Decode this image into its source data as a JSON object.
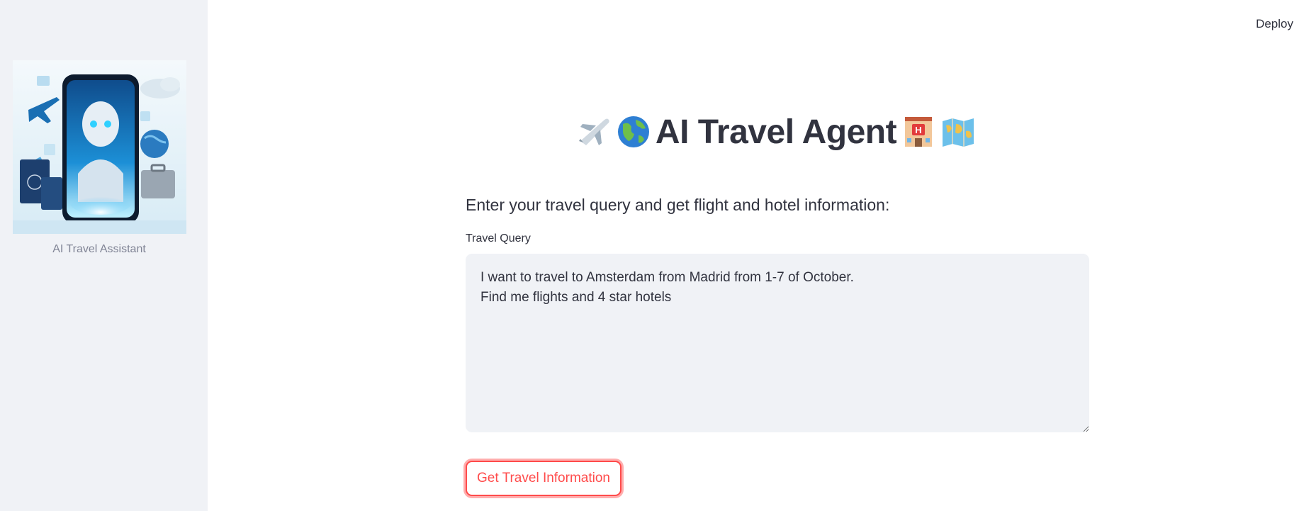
{
  "header": {
    "deploy_label": "Deploy"
  },
  "sidebar": {
    "image_icon": "ai-robot-smartphone-travel-illustration",
    "caption": "AI Travel Assistant"
  },
  "main": {
    "title": {
      "leading_icons": [
        "airplane-icon",
        "globe-icon"
      ],
      "text": "AI Travel Agent",
      "trailing_icons": [
        "hotel-icon",
        "map-icon"
      ]
    },
    "subheader": "Enter your travel query and get flight and hotel information:",
    "query_field": {
      "label": "Travel Query",
      "value": "I want to travel to Amsterdam from Madrid from 1-7 of October.\nFind me flights and 4 star hotels"
    },
    "submit_label": "Get Travel Information"
  },
  "colors": {
    "primary": "#ff4b4b",
    "sidebar_bg": "#f0f2f6",
    "text": "#31333f",
    "caption": "#808495"
  }
}
